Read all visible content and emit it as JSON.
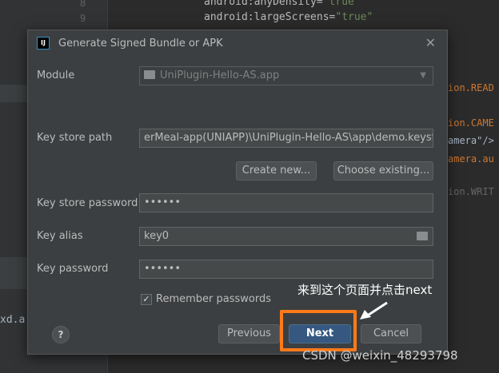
{
  "ide": {
    "line_numbers": [
      "8",
      "9"
    ],
    "code_lines": [
      {
        "attr": "android:anyDensity=",
        "value": "\"true\""
      },
      {
        "attr": "android:largeScreens=",
        "value": "\"true\""
      }
    ],
    "right_fragments": [
      "ion.READ",
      "ion.CAME",
      "amera\"/>",
      "amera.au",
      "ion.WRIT"
    ],
    "bottom_left_text": "xd.a"
  },
  "dialog": {
    "title": "Generate Signed Bundle or APK",
    "icon_label": "IJ",
    "module": {
      "label": "Module",
      "value": "UniPlugin-Hello-AS.app"
    },
    "key_store_path": {
      "label": "Key store path",
      "value": "erMeal-app(UNIAPP)\\UniPlugin-Hello-AS\\app\\demo.keystore"
    },
    "create_new_label": "Create new...",
    "choose_existing_label": "Choose existing...",
    "key_store_password": {
      "label": "Key store password",
      "value": "••••••"
    },
    "key_alias": {
      "label": "Key alias",
      "value": "key0"
    },
    "key_password": {
      "label": "Key password",
      "value": "••••••"
    },
    "remember_passwords": {
      "label": "Remember passwords",
      "checked": true
    },
    "help_label": "?",
    "previous_label": "Previous",
    "next_label": "Next",
    "cancel_label": "Cancel"
  },
  "annotation": {
    "text": "来到这个页面并点击next",
    "highlight_color": "#ff7a1a"
  },
  "watermark": "CSDN @weixin_48293798"
}
